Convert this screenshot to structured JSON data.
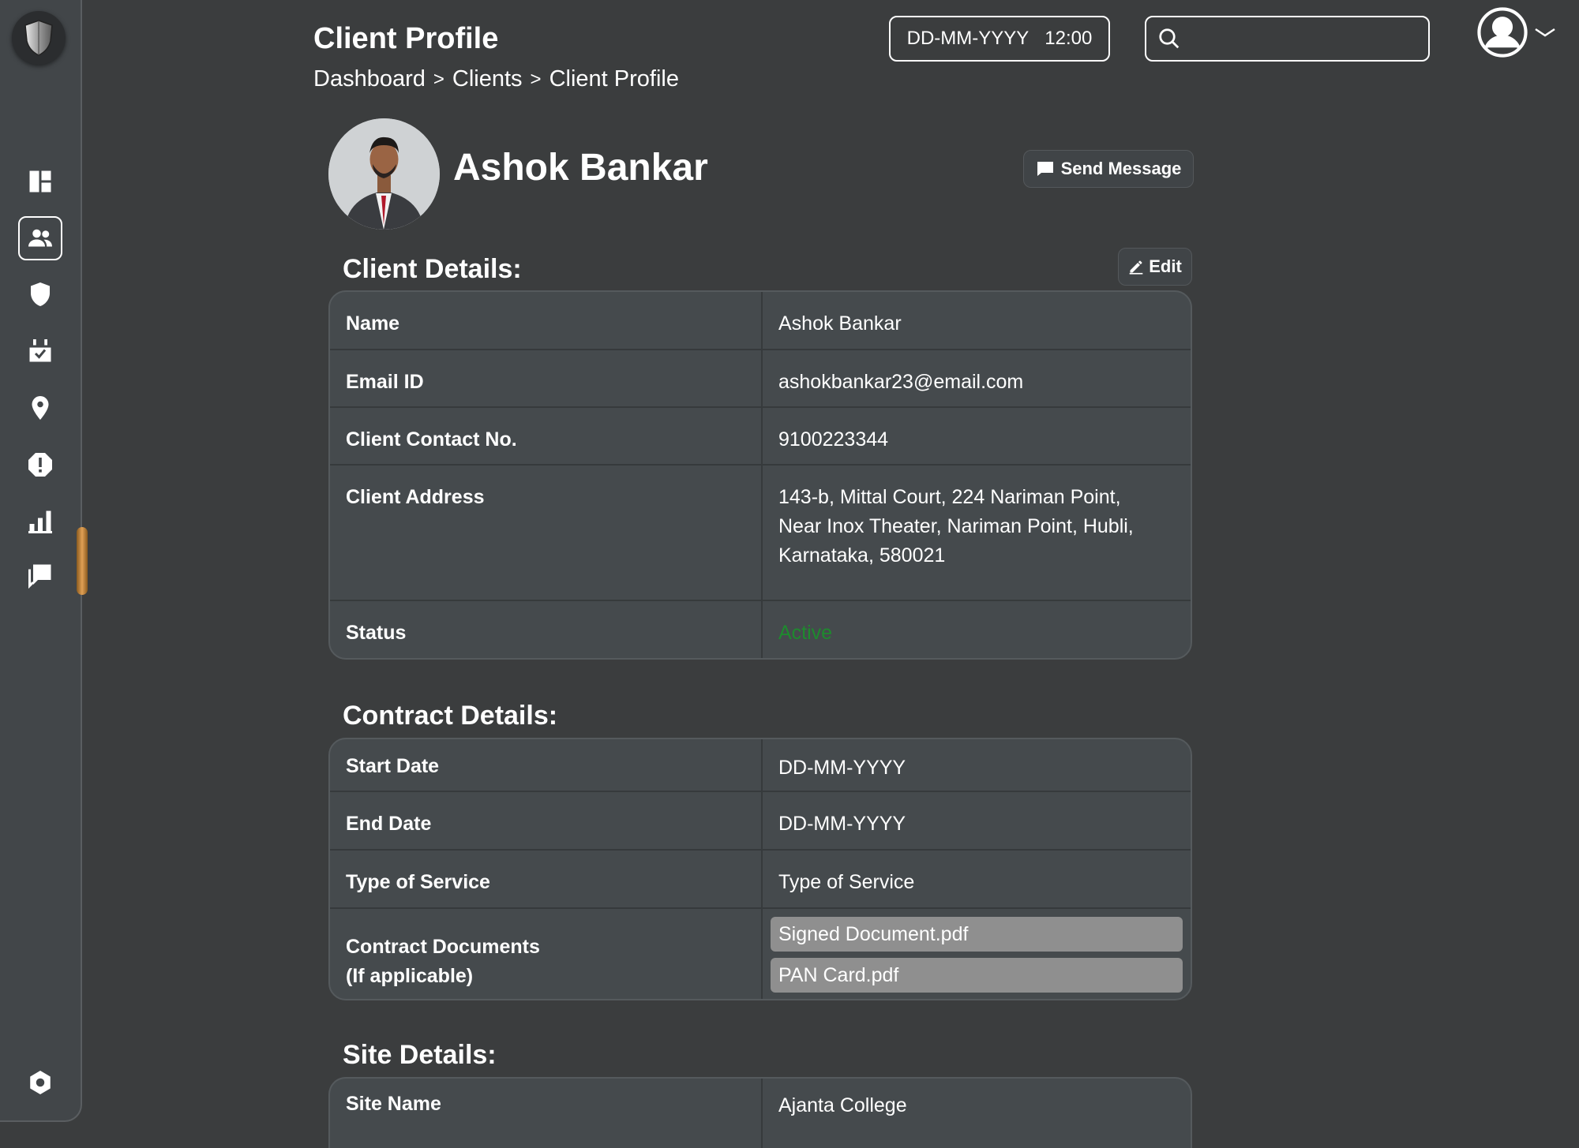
{
  "header": {
    "title": "Client Profile",
    "breadcrumb": [
      "Dashboard",
      "Clients",
      "Client Profile"
    ],
    "date_placeholder": "DD-MM-YYYY",
    "time": "12:00",
    "search_placeholder": ""
  },
  "sidebar": {
    "items": [
      {
        "name": "dashboard",
        "icon": "dashboard-icon",
        "active": false
      },
      {
        "name": "clients",
        "icon": "users-icon",
        "active": true
      },
      {
        "name": "security",
        "icon": "shield-icon",
        "active": false
      },
      {
        "name": "calendar",
        "icon": "calendar-check-icon",
        "active": false
      },
      {
        "name": "locations",
        "icon": "map-pin-icon",
        "active": false
      },
      {
        "name": "alerts",
        "icon": "alert-octagon-icon",
        "active": false
      },
      {
        "name": "reports",
        "icon": "bar-chart-icon",
        "active": false
      },
      {
        "name": "messages",
        "icon": "chat-icon",
        "active": false
      }
    ],
    "settings_icon": "settings-icon"
  },
  "profile": {
    "name": "Ashok Bankar",
    "send_message_label": "Send Message"
  },
  "client_details": {
    "title": "Client Details:",
    "edit_label": "Edit",
    "rows": [
      {
        "label": "Name",
        "value": "Ashok Bankar"
      },
      {
        "label": "Email ID",
        "value": "ashokbankar23@email.com"
      },
      {
        "label": "Client Contact No.",
        "value": "9100223344"
      },
      {
        "label": "Client Address",
        "value": "143-b, Mittal Court, 224 Nariman Point, Near Inox Theater, Nariman Point, Hubli, Karnataka, 580021"
      },
      {
        "label": "Status",
        "value": "Active"
      }
    ]
  },
  "contract_details": {
    "title": "Contract Details:",
    "rows": [
      {
        "label": "Start Date",
        "value": "DD-MM-YYYY"
      },
      {
        "label": "End Date",
        "value": "DD-MM-YYYY"
      },
      {
        "label": "Type of Service",
        "value": "Type of Service"
      },
      {
        "label": "Contract Documents\n(If applicable)",
        "label_line1": "Contract Documents",
        "label_line2": "(If applicable)"
      }
    ],
    "documents": [
      "Signed Document.pdf",
      "PAN Card.pdf"
    ]
  },
  "site_details": {
    "title": "Site Details:",
    "rows": [
      {
        "label": "Site Name",
        "value": "Ajanta College"
      }
    ]
  },
  "colors": {
    "background": "#3b3d3e",
    "sidebar": "#424649",
    "table": "#454a4d",
    "status_active": "#1e8a2e",
    "file_chip": "#8f8f8f",
    "accent_handle": "#c8873c"
  }
}
